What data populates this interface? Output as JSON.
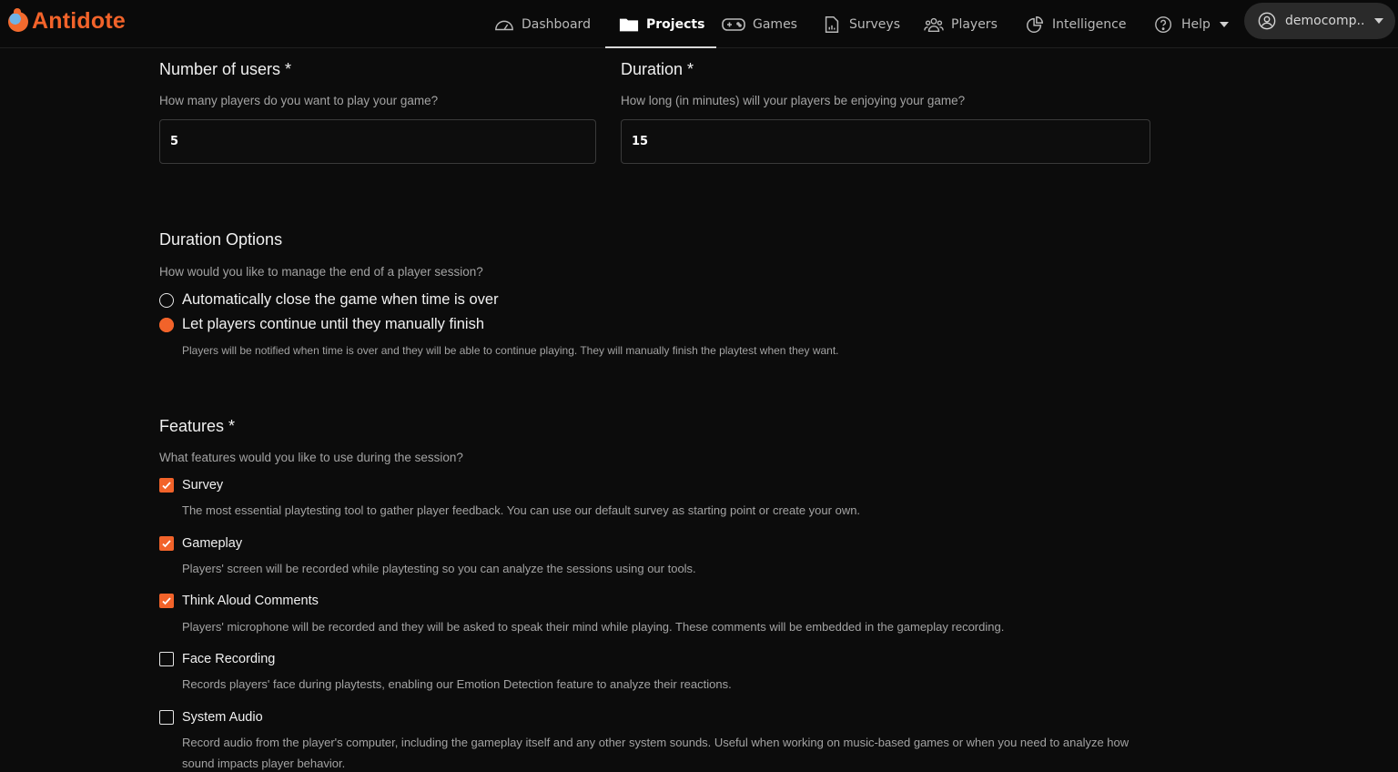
{
  "brand": {
    "name": "Antidote",
    "accent": "#f2632a"
  },
  "nav": {
    "items": [
      {
        "label": "Dashboard",
        "icon": "gauge-icon"
      },
      {
        "label": "Projects",
        "icon": "folder-icon",
        "active": true
      },
      {
        "label": "Games",
        "icon": "gamepad-icon"
      },
      {
        "label": "Surveys",
        "icon": "document-chart-icon"
      },
      {
        "label": "Players",
        "icon": "users-icon"
      },
      {
        "label": "Intelligence",
        "icon": "pie-chart-icon"
      },
      {
        "label": "Help",
        "icon": "question-circle-icon"
      }
    ],
    "account": {
      "label": "democomp..",
      "icon": "user-circle-icon"
    }
  },
  "form": {
    "users": {
      "label": "Number of users *",
      "help": "How many players do you want to play your game?",
      "value": "5"
    },
    "duration": {
      "label": "Duration *",
      "help": "How long (in minutes) will your players be enjoying your game?",
      "value": "15"
    },
    "duration_options": {
      "label": "Duration Options",
      "help": "How would you like to manage the end of a player session?",
      "options": [
        {
          "label": "Automatically close the game when time is over",
          "selected": false
        },
        {
          "label": "Let players continue until they manually finish",
          "selected": true
        }
      ],
      "selected_note": "Players will be notified when time is over and they will be able to continue playing. They will manually finish the playtest when they want."
    },
    "features": {
      "label": "Features *",
      "help": "What features would you like to use during the session?",
      "items": [
        {
          "label": "Survey",
          "checked": true,
          "desc": "The most essential playtesting tool to gather player feedback. You can use our default survey as starting point or create your own."
        },
        {
          "label": "Gameplay",
          "checked": true,
          "desc": "Players' screen will be recorded while playtesting so you can analyze the sessions using our tools."
        },
        {
          "label": "Think Aloud Comments",
          "checked": true,
          "desc": "Players' microphone will be recorded and they will be asked to speak their mind while playing. These comments will be embedded in the gameplay recording."
        },
        {
          "label": "Face Recording",
          "checked": false,
          "desc": "Records players' face during playtests, enabling our Emotion Detection feature to analyze their reactions."
        },
        {
          "label": "System Audio",
          "checked": false,
          "desc": "Record audio from the player's computer, including the gameplay itself and any other system sounds. Useful when working on music-based games or when you need to analyze how",
          "desc2": "sound impacts player behavior."
        }
      ]
    }
  }
}
